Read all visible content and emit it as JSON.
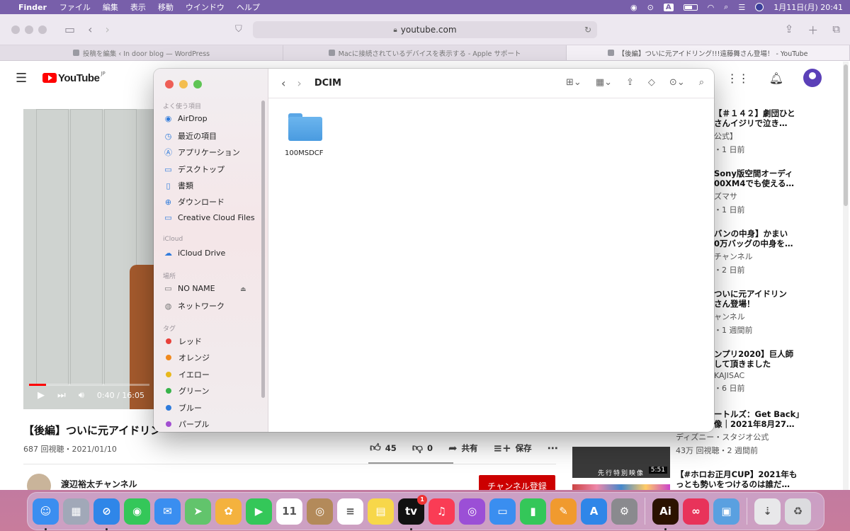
{
  "menubar": {
    "app": "Finder",
    "items": [
      "ファイル",
      "編集",
      "表示",
      "移動",
      "ウインドウ",
      "ヘルプ"
    ],
    "input_indicator": "A",
    "datetime": "1月11日(月)  20:41"
  },
  "safari": {
    "url": "youtube.com",
    "tabs": [
      "投稿を編集 ‹ In door blog — WordPress",
      "Macに接続されているデバイスを表示する - Apple サポート",
      "【後編】ついに元アイドリング!!!遠藤舞さん登場！ - YouTube"
    ],
    "active_tab": 2
  },
  "youtube": {
    "logo_text": "YouTube",
    "logo_region": "JP",
    "player": {
      "time": "0:40 / 16:05",
      "progress": 0.04
    },
    "video_title": "【後編】ついに元アイドリン",
    "video_meta": "687 回視聴・2021/01/10",
    "likes": "45",
    "dislikes": "0",
    "share": "共有",
    "save": "保存",
    "channel_name": "渡辺裕太チャンネル",
    "subscribe": "チャンネル登録",
    "sidebar": [
      {
        "title1": "【＃１４２】劇団ひと",
        "title2": "さんイジリで泣き…",
        "channel": "公式】",
        "meta": "・1 日前"
      },
      {
        "title1": "Sony版空間オーディ",
        "title2": "00XM4でも使える…",
        "channel": "ズマサ",
        "meta": "・1 日前"
      },
      {
        "title1": "バンの中身】かまい",
        "title2": "0万バッグの中身を…",
        "channel": "チャンネル",
        "meta": "・2 日前"
      },
      {
        "title1": "ついに元アイドリン",
        "title2": "さん登場！",
        "channel": "ャンネル",
        "meta": "・1 週間前"
      },
      {
        "title1": "ンプリ2020】巨人師",
        "title2": "して頂きました",
        "channel": "KAJISAC",
        "meta": "・6 日前"
      },
      {
        "title1": "ートルズ：Get Back」",
        "title2": "像｜2021年8月27…",
        "channel": "ディズニー・スタジオ公式",
        "meta": "43万 回視聴・2 週間前"
      },
      {
        "title1": "【#ホロお正月CUP】2021年も",
        "title2": "っとも勢いをつけるのは誰だ…",
        "channel": "",
        "meta": ""
      }
    ],
    "thumb1_label": "先行特別映像",
    "thumb1_duration": "5:51"
  },
  "finder": {
    "title": "DCIM",
    "sections": {
      "favorites": "よく使う項目",
      "icloud": "iCloud",
      "locations": "場所",
      "tags": "タグ"
    },
    "favorites": [
      "AirDrop",
      "最近の項目",
      "アプリケーション",
      "デスクトップ",
      "書類",
      "ダウンロード",
      "Creative Cloud Files"
    ],
    "icloud_items": [
      "iCloud Drive"
    ],
    "locations": [
      "NO NAME",
      "ネットワーク"
    ],
    "tags": [
      {
        "label": "レッド",
        "color": "#e8413a"
      },
      {
        "label": "オレンジ",
        "color": "#f0891e"
      },
      {
        "label": "イエロー",
        "color": "#e8b81c"
      },
      {
        "label": "グリーン",
        "color": "#38b34a"
      },
      {
        "label": "ブルー",
        "color": "#2f7bdc"
      },
      {
        "label": "パープル",
        "color": "#a24fd1"
      }
    ],
    "folder_name": "100MSDCF"
  },
  "dock": {
    "items": [
      {
        "name": "finder",
        "color": "#3a8ef0",
        "glyph": "☺",
        "running": true
      },
      {
        "name": "launchpad",
        "color": "#a1a8b8",
        "glyph": "▦",
        "running": false
      },
      {
        "name": "safari",
        "color": "#2f86e8",
        "glyph": "⊘",
        "running": true
      },
      {
        "name": "messages",
        "color": "#34c759",
        "glyph": "◉",
        "running": false
      },
      {
        "name": "mail",
        "color": "#3a8ef0",
        "glyph": "✉",
        "running": false
      },
      {
        "name": "maps",
        "color": "#62c46c",
        "glyph": "➤",
        "running": false
      },
      {
        "name": "photos",
        "color": "#f4b23e",
        "glyph": "✿",
        "running": false
      },
      {
        "name": "facetime",
        "color": "#34c759",
        "glyph": "▶",
        "running": false
      },
      {
        "name": "calendar",
        "color": "#ffffff",
        "glyph": "11",
        "running": false
      },
      {
        "name": "contacts",
        "color": "#b38a5a",
        "glyph": "◎",
        "running": false
      },
      {
        "name": "reminders",
        "color": "#ffffff",
        "glyph": "≡",
        "running": false
      },
      {
        "name": "notes",
        "color": "#f7d74a",
        "glyph": "▤",
        "running": false
      },
      {
        "name": "apple-tv",
        "color": "#111111",
        "glyph": "tv",
        "running": true,
        "badge": "1"
      },
      {
        "name": "music",
        "color": "#fa3c55",
        "glyph": "♫",
        "running": false
      },
      {
        "name": "podcasts",
        "color": "#9b4fd6",
        "glyph": "◎",
        "running": false
      },
      {
        "name": "keynote",
        "color": "#3a8ef0",
        "glyph": "▭",
        "running": false
      },
      {
        "name": "numbers",
        "color": "#34c759",
        "glyph": "▮",
        "running": false
      },
      {
        "name": "pages",
        "color": "#f09a2e",
        "glyph": "✎",
        "running": false
      },
      {
        "name": "app-store",
        "color": "#2f86e8",
        "glyph": "A",
        "running": false
      },
      {
        "name": "system-preferences",
        "color": "#8a8a8e",
        "glyph": "⚙",
        "running": false
      },
      {
        "name": "illustrator",
        "color": "#2b1200",
        "glyph": "Ai",
        "running": true
      },
      {
        "name": "creative-cloud",
        "color": "#e8335a",
        "glyph": "∞",
        "running": false
      },
      {
        "name": "preview",
        "color": "#5aa0e0",
        "glyph": "▣",
        "running": false
      },
      {
        "name": "downloads-stack",
        "color": "#e8e8ea",
        "glyph": "⇣",
        "running": false
      },
      {
        "name": "trash",
        "color": "#dcdcdf",
        "glyph": "♻",
        "running": false
      }
    ]
  }
}
